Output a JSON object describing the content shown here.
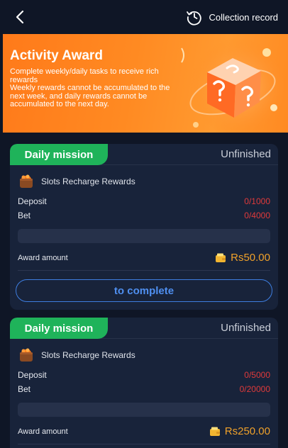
{
  "header": {
    "back_icon": "chevron-left-icon",
    "record_icon": "history-clock-icon",
    "record_label": "Collection record"
  },
  "banner": {
    "title": "Activity Award",
    "description": "Complete weekly/daily tasks to receive rich rewards\nWeekly rewards cannot be accumulated to the next week, and daily rewards cannot be accumulated to the next day.",
    "art": "mystery-cube-icon",
    "colors": {
      "start": "#ff7a1a",
      "end": "#ff9a30"
    }
  },
  "missions": [
    {
      "tag": "Daily mission",
      "status": "Unfinished",
      "task_icon": "basket-icon",
      "task_name": "Slots Recharge Rewards",
      "deposit_label": "Deposit",
      "deposit_value": "0/1000",
      "bet_label": "Bet",
      "bet_value": "0/4000",
      "progress": 0,
      "award_label": "Award amount",
      "award_icon": "wallet-icon",
      "award_value": "Rs50.00",
      "button_label": "to complete"
    },
    {
      "tag": "Daily mission",
      "status": "Unfinished",
      "task_icon": "basket-icon",
      "task_name": "Slots Recharge Rewards",
      "deposit_label": "Deposit",
      "deposit_value": "0/5000",
      "bet_label": "Bet",
      "bet_value": "0/20000",
      "progress": 0,
      "award_label": "Award amount",
      "award_icon": "wallet-icon",
      "award_value": "Rs250.00"
    }
  ],
  "colors": {
    "background": "#0f1626",
    "card": "#18233a",
    "tag_green": "#1fb35a",
    "value_red": "#e03a3a",
    "award_orange": "#f0a12a",
    "button_blue": "#4f8ff0"
  }
}
